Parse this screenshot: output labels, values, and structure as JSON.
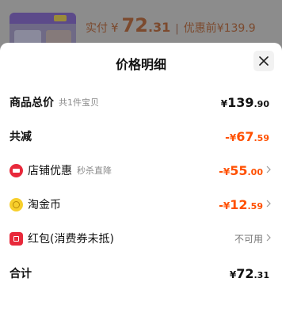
{
  "header": {
    "paid_label": "实付",
    "currency": "¥",
    "paid_int": "72",
    "paid_dec": ".31",
    "separator": "|",
    "orig_label": "优惠前",
    "orig_price": "¥139.9"
  },
  "sheet": {
    "title": "价格明细",
    "close_icon": "close-icon"
  },
  "rows": {
    "total": {
      "label": "商品总价",
      "note": "共1件宝贝",
      "currency": "¥",
      "int": "139",
      "dec": ".90"
    },
    "discount": {
      "label": "共减",
      "sign": "-",
      "currency": "¥",
      "int": "67",
      "dec": ".59"
    },
    "shop": {
      "label": "店铺优惠",
      "note": "秒杀直降",
      "sign": "-",
      "currency": "¥",
      "int": "55",
      "dec": ".00",
      "icon": "shop-icon"
    },
    "coin": {
      "label": "淘金币",
      "sign": "-",
      "currency": "¥",
      "int": "12",
      "dec": ".59",
      "icon": "coin-icon"
    },
    "redpacket": {
      "label": "红包(消费券未抵)",
      "status": "不可用",
      "icon": "red-packet-icon"
    },
    "sum": {
      "label": "合计",
      "currency": "¥",
      "int": "72",
      "dec": ".31"
    }
  },
  "colors": {
    "accent_orange": "#ff5000",
    "red_icon": "#e8293b",
    "coin_yellow": "#f7cf2c",
    "overlay_text": "#7c4a2e"
  }
}
